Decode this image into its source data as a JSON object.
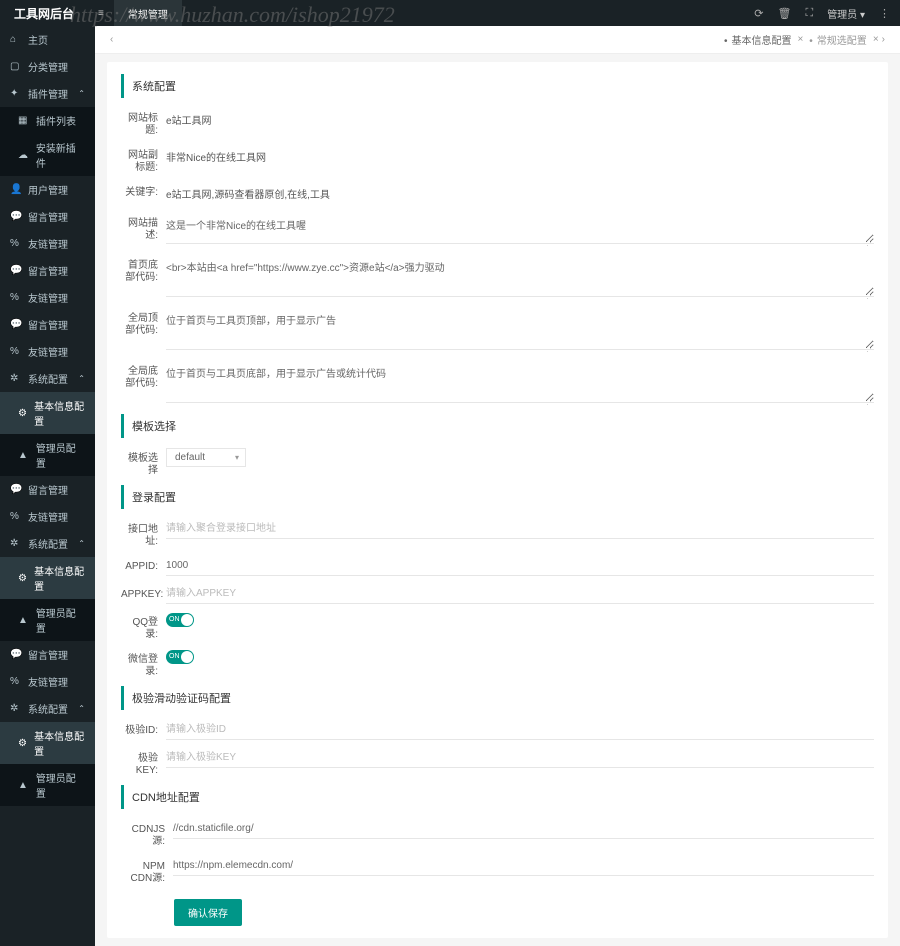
{
  "watermark": "https://www.huzhan.com/ishop21972",
  "brand": "工具网后台",
  "topTabs": {
    "changgui": "常规管理"
  },
  "topRight": {
    "admin": "管理员 ▾"
  },
  "sidebar": {
    "home": "主页",
    "category": "分类管理",
    "plugin": "插件管理",
    "pluginList": "插件列表",
    "pluginInstall": "安装新插件",
    "user": "用户管理",
    "msg": "留言管理",
    "link": "友链管理",
    "sys": "系统配置",
    "basic": "基本信息配置",
    "adminCfg": "管理员配置"
  },
  "breadcrumb": {
    "b1": "基本信息配置",
    "b2": "常规选配置",
    "nav": "›"
  },
  "sec": {
    "s1": "系统配置",
    "s2": "模板选择",
    "s3": "登录配置",
    "s4": "极验滑动验证码配置",
    "s5": "CDN地址配置"
  },
  "labels": {
    "siteTitle": "网站标题:",
    "siteSub": "网站副标题:",
    "keywords": "关键字:",
    "siteDesc": "网站描述:",
    "homeFooter": "首页底部代码:",
    "globalTop": "全局顶部代码:",
    "globalBottom": "全局底部代码:",
    "tplSelect": "模板选择",
    "apiUrl": "接口地址:",
    "appid": "APPID:",
    "appkey": "APPKEY:",
    "qqLogin": "QQ登录:",
    "wxLogin": "微信登录:",
    "jyId": "极验ID:",
    "jyKey": "极验KEY:",
    "cdnjs": "CDNJS源:",
    "npmcdn": "NPM CDN源:"
  },
  "values": {
    "siteTitle": "e站工具网",
    "siteSub": "非常Nice的在线工具网",
    "keywords": "e站工具网,源码查看器原创,在线,工具",
    "siteDesc": "这是一个非常Nice的在线工具喔",
    "homeFooter": "<br>本站由<a href=\"https://www.zye.cc\">资源e站</a>强力驱动",
    "globalTop": "位于首页与工具页顶部，用于显示广告",
    "globalBottom": "位于首页与工具页底部，用于显示广告或统计代码",
    "tpl": "default",
    "appid": "1000",
    "switchOn": "ON",
    "cdnjs": "//cdn.staticfile.org/",
    "npmcdn": "https://npm.elemecdn.com/"
  },
  "placeholders": {
    "apiUrl": "请输入聚合登录接口地址",
    "appkey": "请输入APPKEY",
    "jyId": "请输入极验ID",
    "jyKey": "请输入极验KEY"
  },
  "buttons": {
    "save": "确认保存"
  }
}
